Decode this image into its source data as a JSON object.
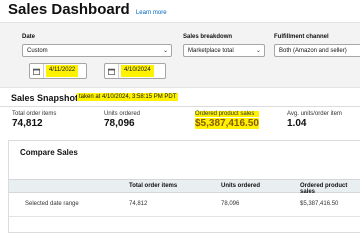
{
  "header": {
    "title": "Sales Dashboard",
    "learn_more": "Learn more"
  },
  "filters": {
    "date_label": "Date",
    "date_value": "Custom",
    "start_date": "4/11/2022",
    "end_date": "4/10/2024",
    "breakdown_label": "Sales breakdown",
    "breakdown_value": "Marketplace total",
    "channel_label": "Fulfillment channel",
    "channel_value": "Both (Amazon and seller)"
  },
  "snapshot": {
    "title": "Sales Snapshot",
    "taken_at": "taken at 4/10/2024, 3:58:15 PM PDT",
    "metrics": [
      {
        "label": "Total order items",
        "value": "74,812"
      },
      {
        "label": "Units ordered",
        "value": "78,096"
      },
      {
        "label": "Ordered product sales",
        "value": "$5,387,416.50"
      },
      {
        "label": "Avg. units/order item",
        "value": "1.04"
      }
    ]
  },
  "compare": {
    "title": "Compare Sales",
    "columns": [
      "Total order items",
      "Units ordered",
      "Ordered product sales"
    ],
    "rows": [
      {
        "label": "Selected date range",
        "values": [
          "74,812",
          "78,096",
          "$5,387,416.50"
        ]
      }
    ]
  },
  "colors": {
    "highlight": "#fff200",
    "link": "#0066c0",
    "panel": "#f3f3f3"
  }
}
